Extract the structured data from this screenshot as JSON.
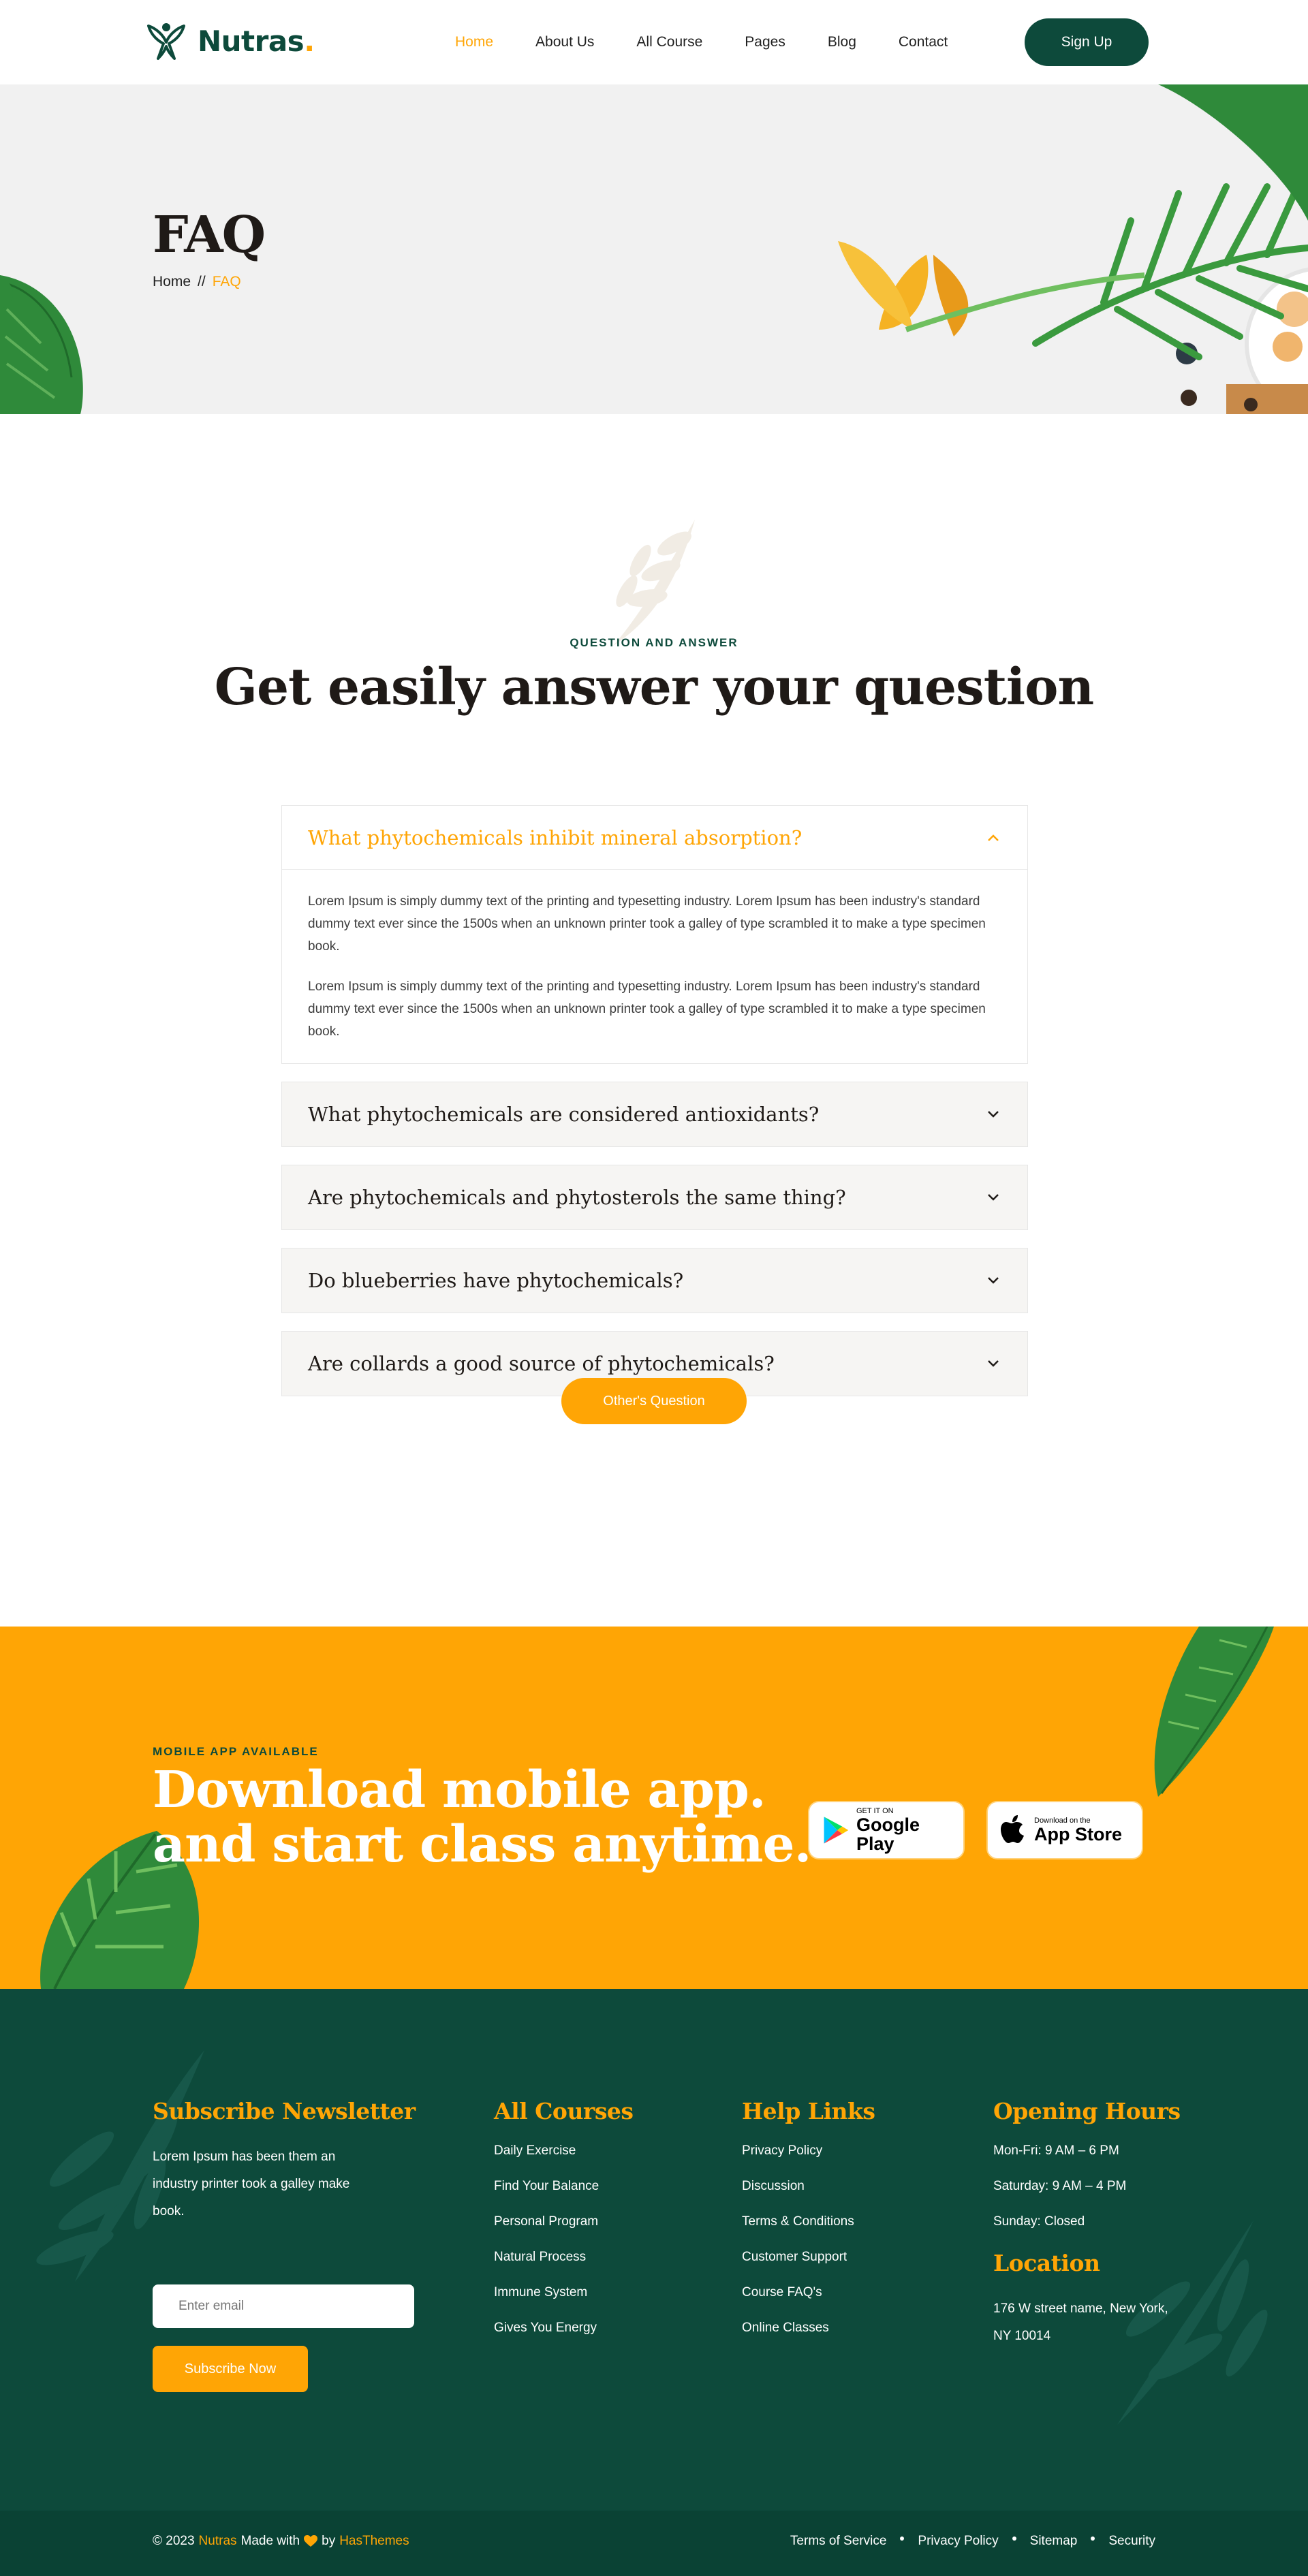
{
  "brand": {
    "name": "Nutras",
    "dot": "."
  },
  "nav": {
    "items": [
      {
        "label": "Home",
        "active": true
      },
      {
        "label": "About Us",
        "active": false
      },
      {
        "label": "All Course",
        "active": false
      },
      {
        "label": "Pages",
        "active": false
      },
      {
        "label": "Blog",
        "active": false
      },
      {
        "label": "Contact",
        "active": false
      }
    ],
    "signup": "Sign Up"
  },
  "hero": {
    "title": "FAQ",
    "breadcrumb": {
      "home": "Home",
      "separator": "//",
      "current": "FAQ"
    }
  },
  "faq": {
    "kicker": "QUESTION AND ANSWER",
    "heading": "Get easily answer your question",
    "items": [
      {
        "question": "What phytochemicals inhibit mineral absorption?",
        "open": true,
        "answers": [
          "Lorem Ipsum is simply dummy text of the printing and typesetting industry. Lorem Ipsum has been industry's standard dummy text ever since the 1500s when an unknown printer took a galley of type scrambled it to make a type specimen book.",
          "Lorem Ipsum is simply dummy text of the printing and typesetting industry. Lorem Ipsum has been industry's standard dummy text ever since the 1500s when an unknown printer took a galley of type scrambled it to make a type specimen book."
        ]
      },
      {
        "question": "What phytochemicals are considered antioxidants?",
        "open": false
      },
      {
        "question": "Are phytochemicals and phytosterols the same thing?",
        "open": false
      },
      {
        "question": "Do blueberries have phytochemicals?",
        "open": false
      },
      {
        "question": "Are collards a good source of phytochemicals?",
        "open": false
      }
    ],
    "others_button": "Other's Question"
  },
  "app": {
    "kicker": "MOBILE APP AVAILABLE",
    "title_line1": "Download mobile app.",
    "title_line2": "and start class anytime.",
    "google": {
      "small": "GET IT ON",
      "big": "Google Play"
    },
    "apple": {
      "small": "Download on the",
      "big": "App Store"
    }
  },
  "footer": {
    "newsletter": {
      "title": "Subscribe Newsletter",
      "text": "Lorem Ipsum has been them an industry printer took a galley make book.",
      "email_placeholder": "Enter email",
      "button": "Subscribe Now"
    },
    "courses": {
      "title": "All Courses",
      "links": [
        "Daily Exercise",
        "Find Your Balance",
        "Personal Program",
        "Natural Process",
        "Immune System",
        "Gives You Energy"
      ]
    },
    "help": {
      "title": "Help Links",
      "links": [
        "Privacy Policy",
        "Discussion",
        "Terms & Conditions",
        "Customer Support",
        "Course FAQ's",
        "Online Classes"
      ]
    },
    "hours": {
      "title": "Opening Hours",
      "lines": [
        "Mon-Fri: 9 AM – 6 PM",
        "Saturday: 9 AM – 4 PM",
        "Sunday: Closed"
      ]
    },
    "location": {
      "title": "Location",
      "address": "176 W street name, New York, NY 10014"
    }
  },
  "copyright": {
    "prefix": "© 2023",
    "brand": "Nutras",
    "made_with": "Made with",
    "by": "by",
    "author": "HasThemes",
    "links": [
      "Terms of Service",
      "Privacy Policy",
      "Sitemap",
      "Security"
    ]
  },
  "colors": {
    "primary": "#0d4a3b",
    "accent": "#ffa505",
    "hero_bg": "#f1f1f1",
    "footer_bg": "#0d4a3b"
  }
}
